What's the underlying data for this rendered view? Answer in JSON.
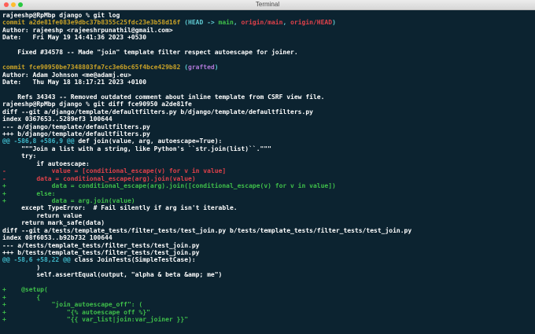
{
  "window": {
    "title": "Terminal"
  },
  "lines": [
    [
      {
        "t": "rajeeshp@RpMbp django % git log",
        "c": "white"
      }
    ],
    [
      {
        "t": "commit a2de81fe083e9dbc37b8355c25fdc23e3b58d16f ",
        "c": "commit"
      },
      {
        "t": "(",
        "c": "paren"
      },
      {
        "t": "HEAD -> ",
        "c": "paren"
      },
      {
        "t": "main",
        "c": "green"
      },
      {
        "t": ", ",
        "c": "paren"
      },
      {
        "t": "origin/main",
        "c": "red"
      },
      {
        "t": ", ",
        "c": "paren"
      },
      {
        "t": "origin/HEAD",
        "c": "red"
      },
      {
        "t": ")",
        "c": "paren"
      }
    ],
    [
      {
        "t": "Author: rajeeshp <rajeeshrpunathil@gmail.com>",
        "c": "white"
      }
    ],
    [
      {
        "t": "Date:   Fri May 19 14:41:36 2023 +0530",
        "c": "white"
      }
    ],
    [
      {
        "t": "",
        "c": "white"
      }
    ],
    [
      {
        "t": "    Fixed #34578 -- Made \"join\" template filter respect autoescape for joiner.",
        "c": "white"
      }
    ],
    [
      {
        "t": "",
        "c": "white"
      }
    ],
    [
      {
        "t": "commit fce90950be7348803fa7cc3e6bc65f4bce429b82 ",
        "c": "commit"
      },
      {
        "t": "(",
        "c": "paren"
      },
      {
        "t": "grafted",
        "c": "purple"
      },
      {
        "t": ")",
        "c": "paren"
      }
    ],
    [
      {
        "t": "Author: Adam Johnson <me@adamj.eu>",
        "c": "white"
      }
    ],
    [
      {
        "t": "Date:   Thu May 18 18:17:21 2023 +0100",
        "c": "white"
      }
    ],
    [
      {
        "t": "",
        "c": "white"
      }
    ],
    [
      {
        "t": "    Refs 34343 -- Removed outdated comment about inline template from CSRF view file.",
        "c": "white"
      }
    ],
    [
      {
        "t": "rajeeshp@RpMbp django % git diff fce90950 a2de81fe",
        "c": "white"
      }
    ],
    [
      {
        "t": "diff --git a/django/template/defaultfilters.py b/django/template/defaultfilters.py",
        "c": "white"
      }
    ],
    [
      {
        "t": "index 0367653..5289ef3 100644",
        "c": "white"
      }
    ],
    [
      {
        "t": "--- a/django/template/defaultfilters.py",
        "c": "white"
      }
    ],
    [
      {
        "t": "+++ b/django/template/defaultfilters.py",
        "c": "white"
      }
    ],
    [
      {
        "t": "@@ -586,8 +586,9 @@",
        "c": "cyan"
      },
      {
        "t": " def join(value, arg, autoescape=True):",
        "c": "white"
      }
    ],
    [
      {
        "t": "     \"\"\"Join a list with a string, like Python's ``str.join(list)``.\"\"\"",
        "c": "white"
      }
    ],
    [
      {
        "t": "     try:",
        "c": "white"
      }
    ],
    [
      {
        "t": "         if autoescape:",
        "c": "white"
      }
    ],
    [
      {
        "t": "-            value = [conditional_escape(v) for v in value]",
        "c": "red"
      }
    ],
    [
      {
        "t": "-        data = conditional_escape(arg).join(value)",
        "c": "red"
      }
    ],
    [
      {
        "t": "+            data = conditional_escape(arg).join([conditional_escape(v) for v in value])",
        "c": "green"
      }
    ],
    [
      {
        "t": "+        else:",
        "c": "green"
      }
    ],
    [
      {
        "t": "+            data = arg.join(value)",
        "c": "green"
      }
    ],
    [
      {
        "t": "     except TypeError:  # Fail silently if arg isn't iterable.",
        "c": "white"
      }
    ],
    [
      {
        "t": "         return value",
        "c": "white"
      }
    ],
    [
      {
        "t": "     return mark_safe(data)",
        "c": "white"
      }
    ],
    [
      {
        "t": "diff --git a/tests/template_tests/filter_tests/test_join.py b/tests/template_tests/filter_tests/test_join.py",
        "c": "white"
      }
    ],
    [
      {
        "t": "index 08f6053..b92b732 100644",
        "c": "white"
      }
    ],
    [
      {
        "t": "--- a/tests/template_tests/filter_tests/test_join.py",
        "c": "white"
      }
    ],
    [
      {
        "t": "+++ b/tests/template_tests/filter_tests/test_join.py",
        "c": "white"
      }
    ],
    [
      {
        "t": "@@ -58,6 +58,22 @@",
        "c": "cyan"
      },
      {
        "t": " class JoinTests(SimpleTestCase):",
        "c": "white"
      }
    ],
    [
      {
        "t": "         )",
        "c": "white"
      }
    ],
    [
      {
        "t": "         self.assertEqual(output, \"alpha & beta &amp; me\")",
        "c": "white"
      }
    ],
    [
      {
        "t": "",
        "c": "white"
      }
    ],
    [
      {
        "t": "+    @setup(",
        "c": "green"
      }
    ],
    [
      {
        "t": "+        {",
        "c": "green"
      }
    ],
    [
      {
        "t": "+            \"join_autoescape_off\": (",
        "c": "green"
      }
    ],
    [
      {
        "t": "+                \"{% autoescape off %}\"",
        "c": "green"
      }
    ],
    [
      {
        "t": "+                \"{{ var_list|join:var_joiner }}\"",
        "c": "green"
      }
    ]
  ]
}
